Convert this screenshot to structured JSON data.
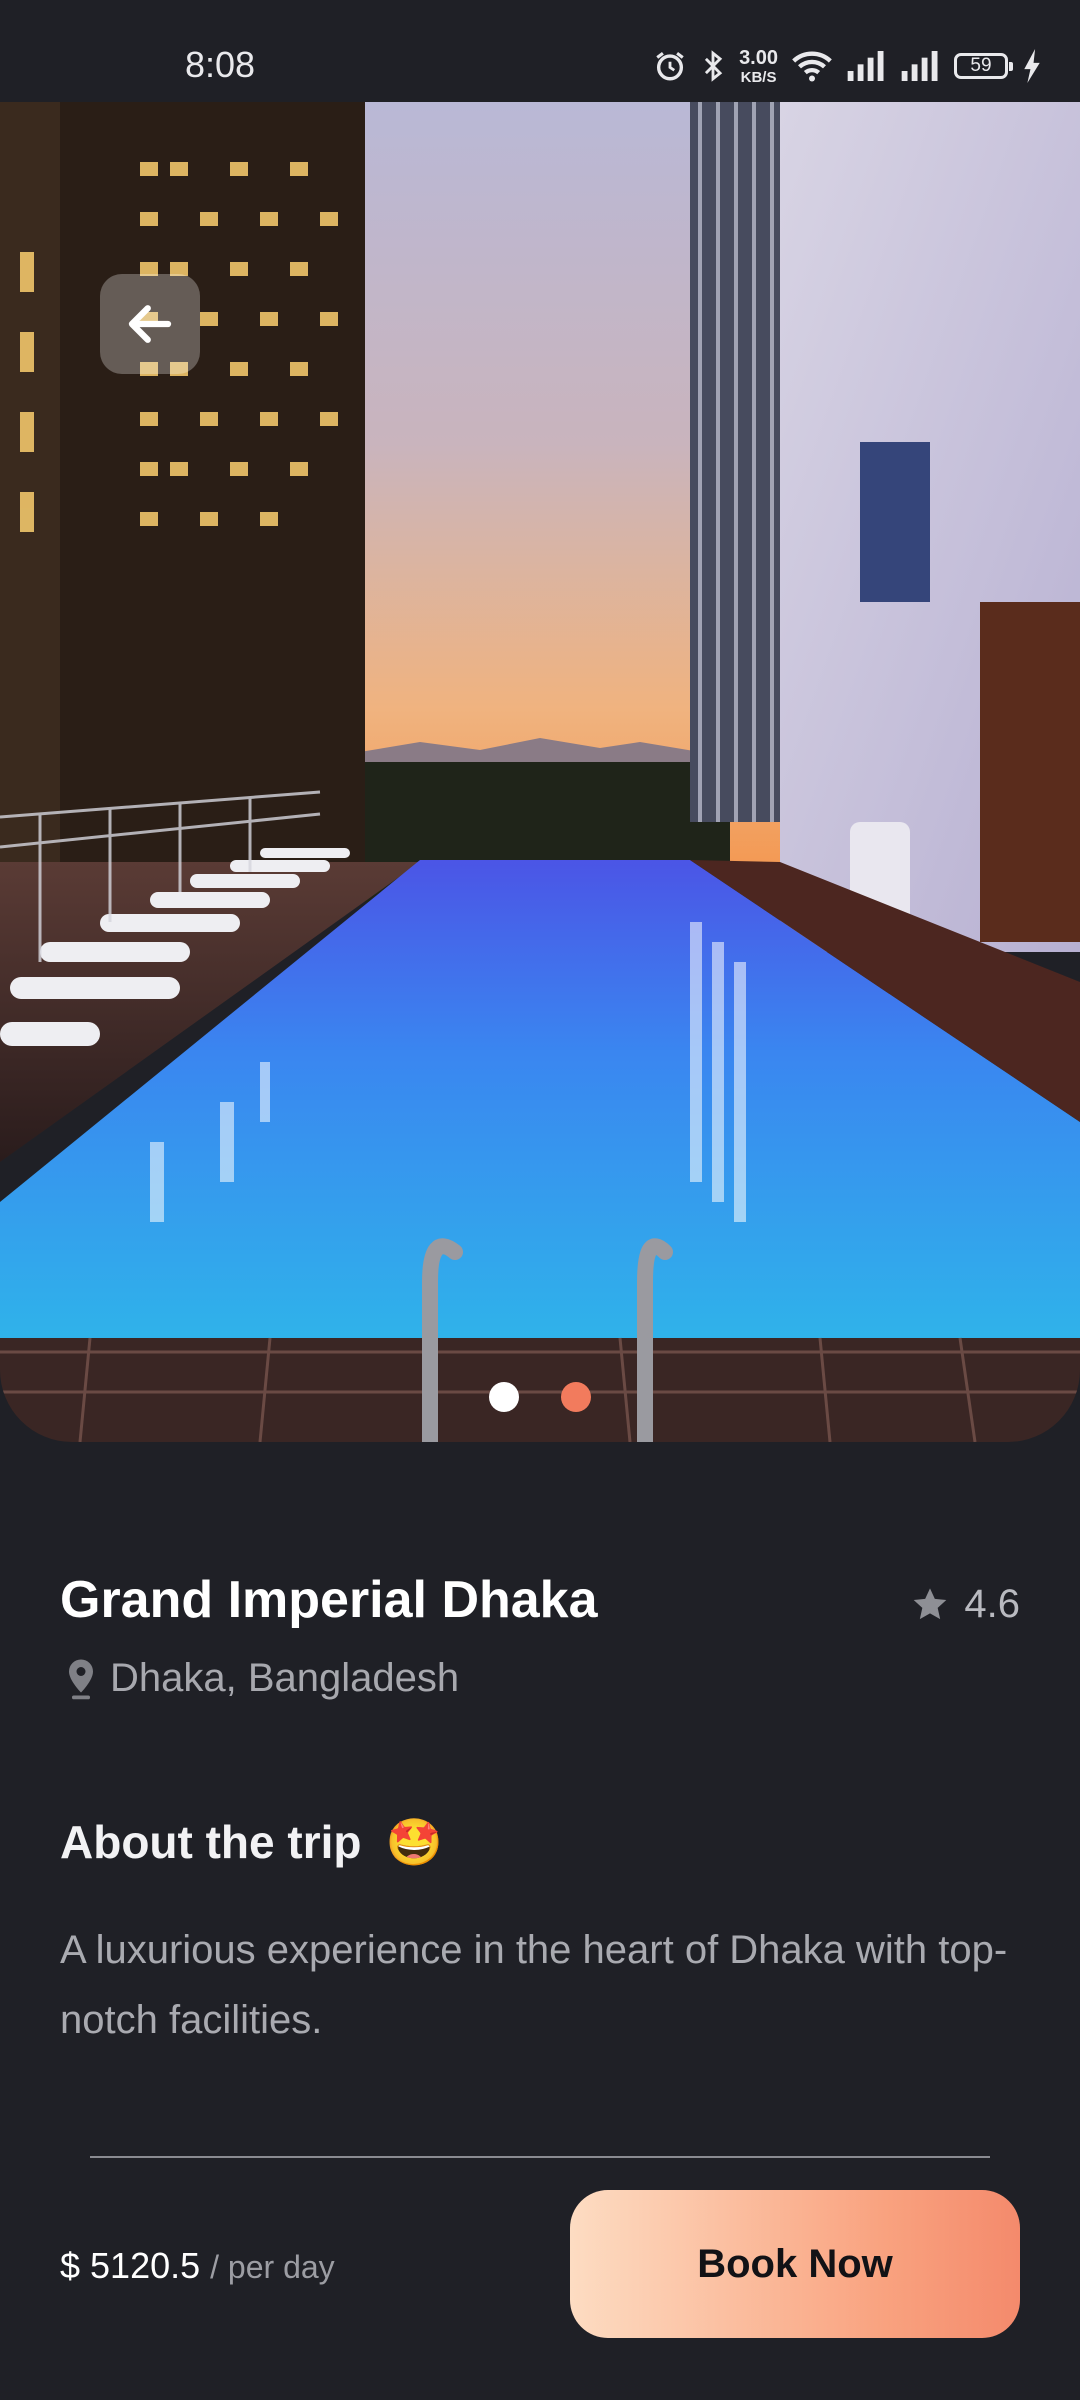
{
  "status_bar": {
    "time": "8:08",
    "net_speed": "3.00",
    "net_unit": "KB/S",
    "battery": "59",
    "icons": [
      "alarm-icon",
      "bluetooth-icon",
      "wifi-icon",
      "signal-icon",
      "signal-icon",
      "charging-icon"
    ]
  },
  "gallery": {
    "slide_count": 2,
    "active_slide": 1,
    "dot_colors": {
      "active": "#ffffff",
      "inactive": "#f27b5d"
    }
  },
  "hotel": {
    "name": "Grand Imperial Dhaka",
    "rating": "4.6",
    "location": "Dhaka, Bangladesh"
  },
  "about": {
    "title": "About the trip",
    "emoji": "🤩",
    "description": "A luxurious experience in the heart of Dhaka with top-notch facilities."
  },
  "footer": {
    "price": "$ 5120.5",
    "price_unit": "/ per day",
    "book_label": "Book Now"
  },
  "colors": {
    "background": "#1f2026",
    "accent_start": "#fddcc2",
    "accent_end": "#f48a6c"
  }
}
